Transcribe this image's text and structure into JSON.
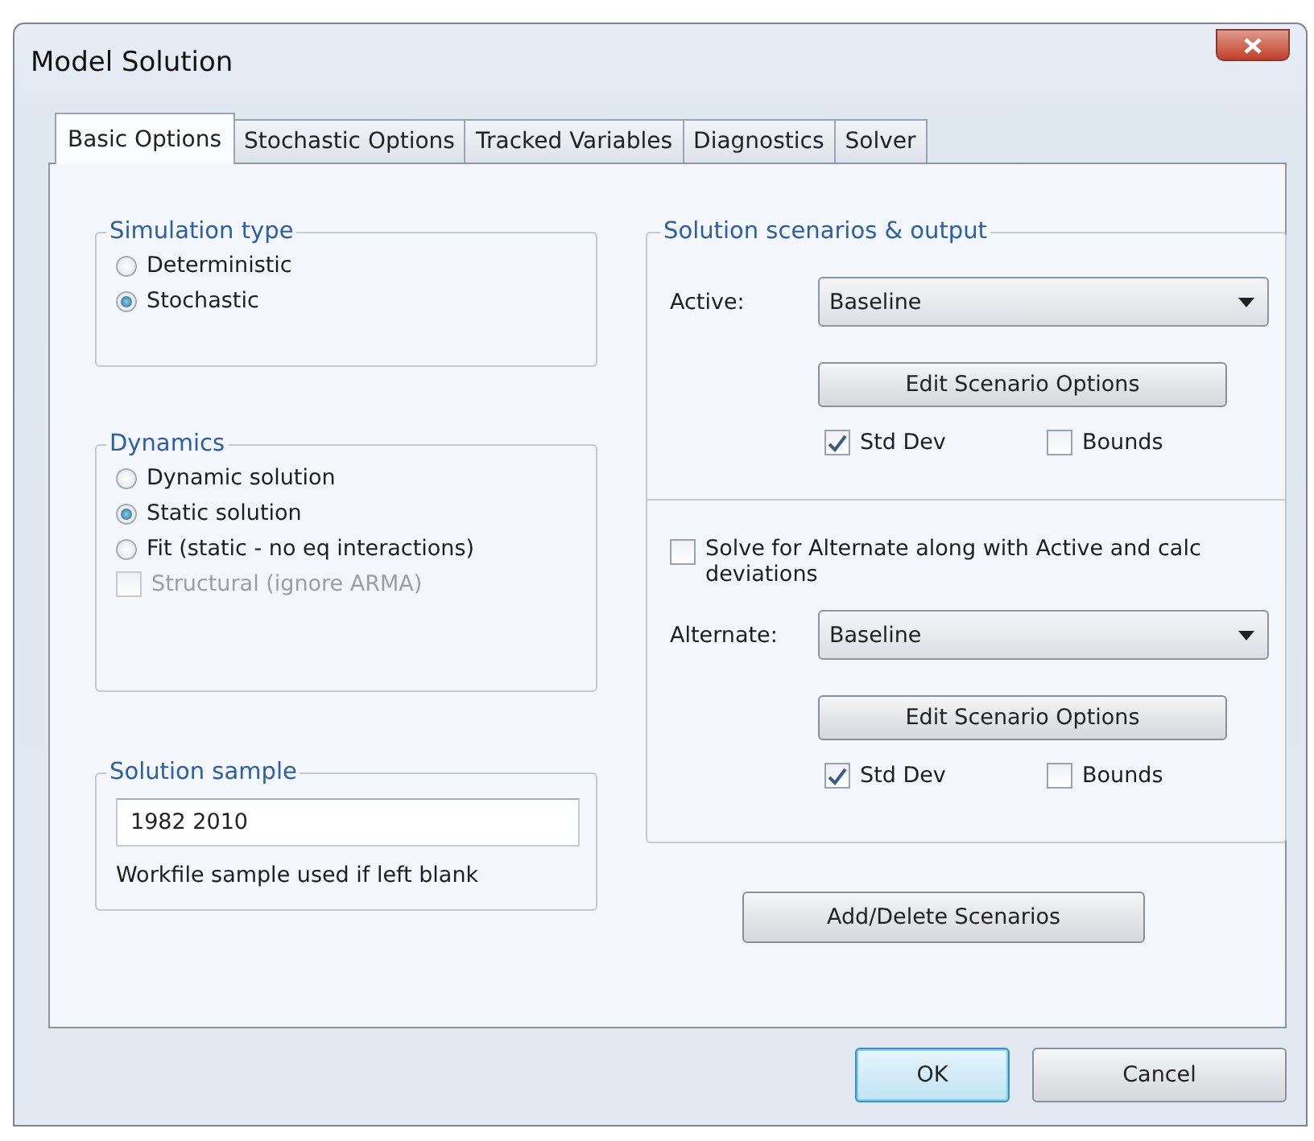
{
  "window": {
    "title": "Model Solution"
  },
  "tabs": [
    {
      "label": "Basic Options",
      "selected": true
    },
    {
      "label": "Stochastic Options",
      "selected": false
    },
    {
      "label": "Tracked Variables",
      "selected": false
    },
    {
      "label": "Diagnostics",
      "selected": false
    },
    {
      "label": "Solver",
      "selected": false
    }
  ],
  "simulation_type": {
    "title": "Simulation type",
    "options": [
      {
        "label": "Deterministic",
        "selected": false
      },
      {
        "label": "Stochastic",
        "selected": true
      }
    ]
  },
  "dynamics": {
    "title": "Dynamics",
    "options": [
      {
        "label": "Dynamic solution",
        "selected": false
      },
      {
        "label": "Static solution",
        "selected": true
      },
      {
        "label": "Fit (static - no eq interactions)",
        "selected": false
      }
    ],
    "structural": {
      "label": "Structural (ignore ARMA)",
      "checked": false,
      "disabled": true
    }
  },
  "solution_sample": {
    "title": "Solution sample",
    "value": "1982 2010",
    "note": "Workfile sample used if left blank"
  },
  "scenarios": {
    "title": "Solution scenarios & output",
    "active": {
      "label": "Active:",
      "value": "Baseline",
      "button": "Edit Scenario Options",
      "checks": [
        {
          "label": "Std Dev",
          "checked": true
        },
        {
          "label": "Bounds",
          "checked": false
        }
      ]
    },
    "solve_alternate": {
      "label": "Solve for Alternate along with Active and calc deviations",
      "checked": false
    },
    "alternate": {
      "label": "Alternate:",
      "value": "Baseline",
      "button": "Edit Scenario Options",
      "checks": [
        {
          "label": "Std Dev",
          "checked": true
        },
        {
          "label": "Bounds",
          "checked": false
        }
      ]
    }
  },
  "add_delete_button": "Add/Delete Scenarios",
  "buttons": [
    {
      "label": "OK",
      "default": true
    },
    {
      "label": "Cancel",
      "default": false
    }
  ]
}
